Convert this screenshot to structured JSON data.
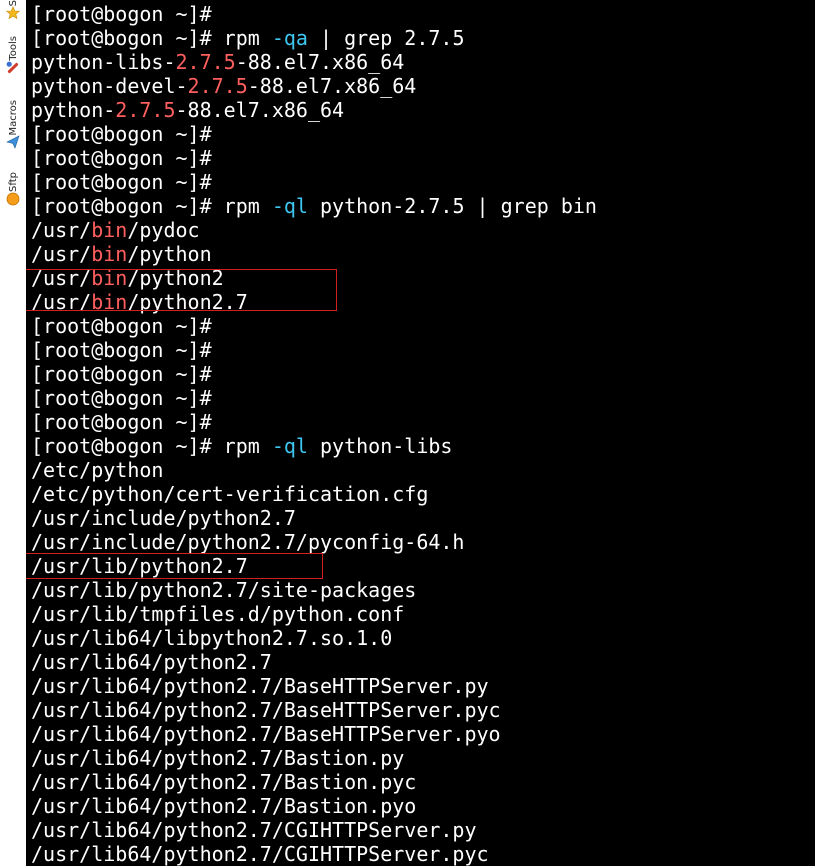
{
  "colors": {
    "background": "#000000",
    "text": "#ffffff",
    "cyan": "#3ec7f0",
    "red": "#ff5f5f",
    "highlight_box": "#d02020"
  },
  "sidebar": {
    "tabs": [
      {
        "label": "S",
        "icon": "star-icon"
      },
      {
        "label": "Tools",
        "icon": "wrench-icon"
      },
      {
        "label": "Macros",
        "icon": "paper-plane-icon"
      },
      {
        "label": "Sftp",
        "icon": "sftp-icon"
      }
    ]
  },
  "terminal": {
    "lines": [
      [
        {
          "t": "[root@bogon ~]#"
        }
      ],
      [
        {
          "t": "[root@bogon ~]# rpm "
        },
        {
          "t": "-qa",
          "c": "cyan"
        },
        {
          "t": " | grep 2.7.5"
        }
      ],
      [
        {
          "t": "python-libs-"
        },
        {
          "t": "2.7.5",
          "c": "red"
        },
        {
          "t": "-88.el7.x86_64"
        }
      ],
      [
        {
          "t": "python-devel-"
        },
        {
          "t": "2.7.5",
          "c": "red"
        },
        {
          "t": "-88.el7.x86_64"
        }
      ],
      [
        {
          "t": "python-"
        },
        {
          "t": "2.7.5",
          "c": "red"
        },
        {
          "t": "-88.el7.x86_64"
        }
      ],
      [
        {
          "t": "[root@bogon ~]#"
        }
      ],
      [
        {
          "t": "[root@bogon ~]#"
        }
      ],
      [
        {
          "t": "[root@bogon ~]#"
        }
      ],
      [
        {
          "t": "[root@bogon ~]# rpm "
        },
        {
          "t": "-ql",
          "c": "cyan"
        },
        {
          "t": " python-2.7.5 | grep bin"
        }
      ],
      [
        {
          "t": "/usr/"
        },
        {
          "t": "bin",
          "c": "red"
        },
        {
          "t": "/pydoc"
        }
      ],
      [
        {
          "t": "/usr/"
        },
        {
          "t": "bin",
          "c": "red"
        },
        {
          "t": "/python"
        }
      ],
      [
        {
          "t": "/usr/"
        },
        {
          "t": "bin",
          "c": "red"
        },
        {
          "t": "/python2"
        }
      ],
      [
        {
          "t": "/usr/"
        },
        {
          "t": "bin",
          "c": "red"
        },
        {
          "t": "/python2.7"
        }
      ],
      [
        {
          "t": "[root@bogon ~]#"
        }
      ],
      [
        {
          "t": "[root@bogon ~]#"
        }
      ],
      [
        {
          "t": "[root@bogon ~]#"
        }
      ],
      [
        {
          "t": "[root@bogon ~]#"
        }
      ],
      [
        {
          "t": "[root@bogon ~]#"
        }
      ],
      [
        {
          "t": "[root@bogon ~]# rpm "
        },
        {
          "t": "-ql",
          "c": "cyan"
        },
        {
          "t": " python-libs"
        }
      ],
      [
        {
          "t": "/etc/python"
        }
      ],
      [
        {
          "t": "/etc/python/cert-verification.cfg"
        }
      ],
      [
        {
          "t": "/usr/include/python2.7"
        }
      ],
      [
        {
          "t": "/usr/include/python2.7/pyconfig-64.h"
        }
      ],
      [
        {
          "t": "/usr/lib/python2.7"
        }
      ],
      [
        {
          "t": "/usr/lib/python2.7/site-packages"
        }
      ],
      [
        {
          "t": "/usr/lib/tmpfiles.d/python.conf"
        }
      ],
      [
        {
          "t": "/usr/lib64/libpython2.7.so.1.0"
        }
      ],
      [
        {
          "t": "/usr/lib64/python2.7"
        }
      ],
      [
        {
          "t": "/usr/lib64/python2.7/BaseHTTPServer.py"
        }
      ],
      [
        {
          "t": "/usr/lib64/python2.7/BaseHTTPServer.pyc"
        }
      ],
      [
        {
          "t": "/usr/lib64/python2.7/BaseHTTPServer.pyo"
        }
      ],
      [
        {
          "t": "/usr/lib64/python2.7/Bastion.py"
        }
      ],
      [
        {
          "t": "/usr/lib64/python2.7/Bastion.pyc"
        }
      ],
      [
        {
          "t": "/usr/lib64/python2.7/Bastion.pyo"
        }
      ],
      [
        {
          "t": "/usr/lib64/python2.7/CGIHTTPServer.py"
        }
      ],
      [
        {
          "t": "/usr/lib64/python2.7/CGIHTTPServer.pyc"
        }
      ]
    ]
  }
}
